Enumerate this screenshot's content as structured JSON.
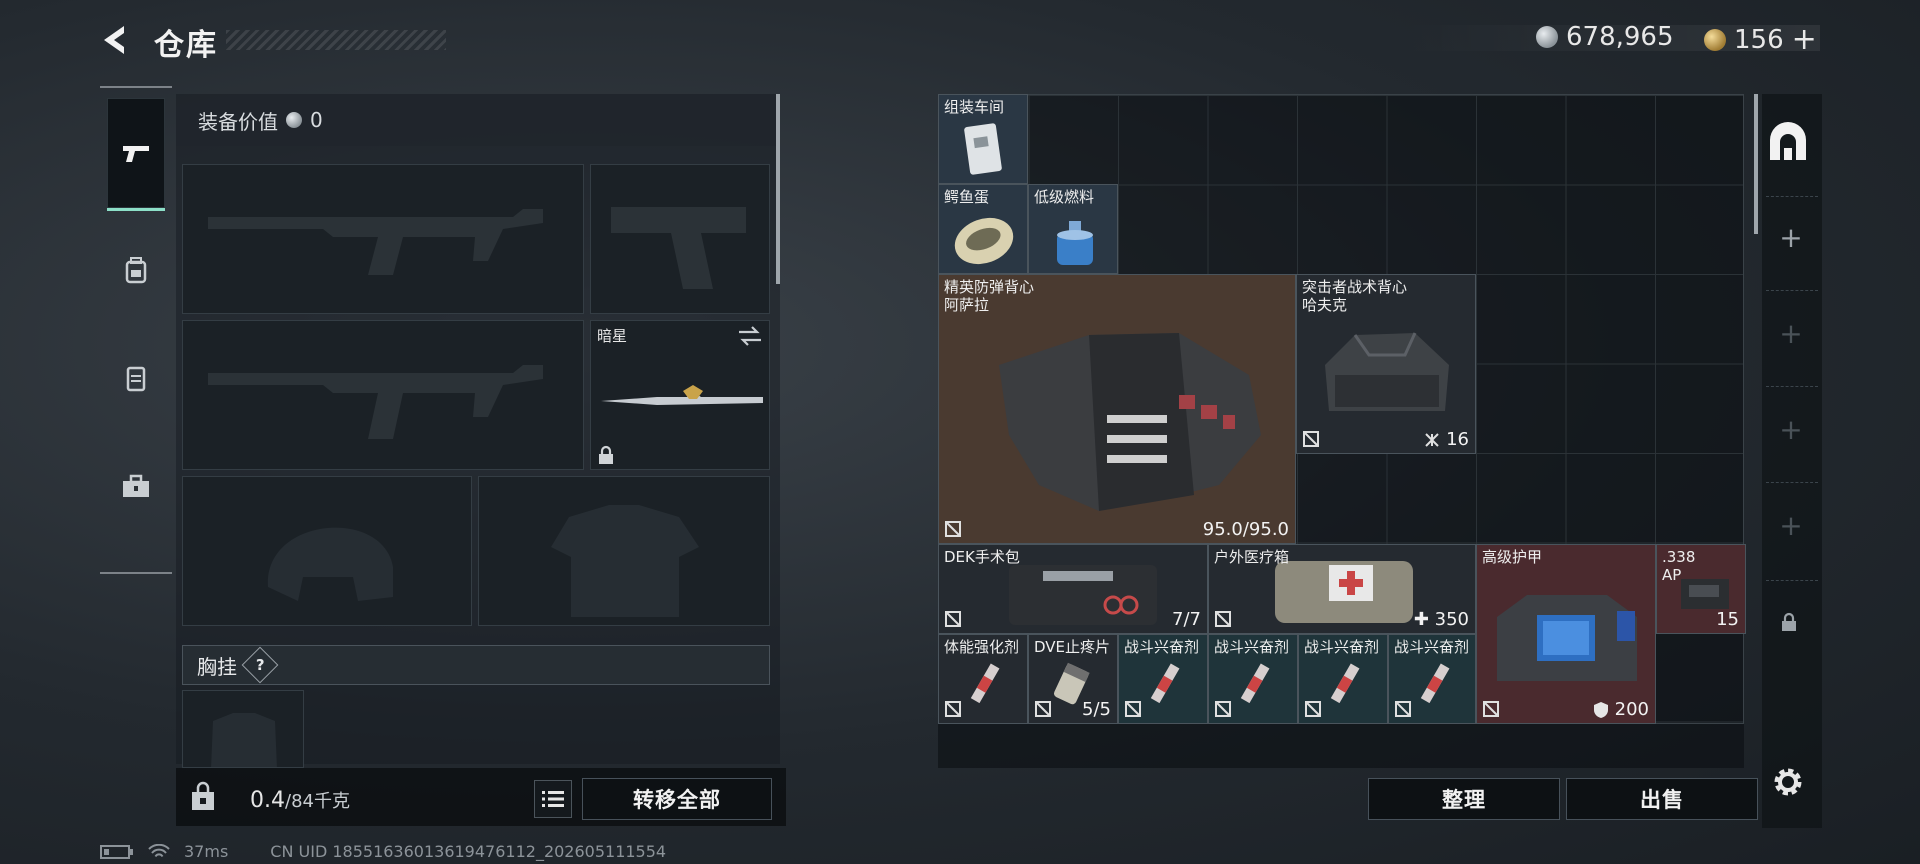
{
  "header": {
    "title": "仓库",
    "currency_silver": "678,965",
    "currency_gold": "156",
    "gold_add": "+",
    "colors": {
      "accent": "#8de0c8",
      "text": "#f2f2f2"
    }
  },
  "tabs": [
    {
      "icon": "pistol-icon",
      "active": true
    },
    {
      "icon": "backpack-icon",
      "active": false
    },
    {
      "icon": "vest-icon",
      "active": false
    },
    {
      "icon": "toolbox-icon",
      "active": false
    }
  ],
  "loadout": {
    "value_label": "装备价值",
    "value": "0",
    "melee_label": "暗星",
    "chest_rig_label": "胸挂",
    "chest_rig_help": "?",
    "weight_value": "0.4",
    "weight_max": "/84千克",
    "transfer_all": "转移全部"
  },
  "stash": {
    "items": [
      {
        "name": "组装车间",
        "color": "blue"
      },
      {
        "name": "鳄鱼蛋",
        "color": "blue"
      },
      {
        "name": "低级燃料",
        "color": "blue"
      },
      {
        "name": "精英防弹背心\n阿萨拉",
        "qty": "95.0/95.0",
        "color": "brown"
      },
      {
        "name": "突击者战术背心\n哈夫克",
        "qty": "16",
        "color": "dark"
      },
      {
        "name": "DEK手术包",
        "qty": "7/7",
        "color": "dark"
      },
      {
        "name": "户外医疗箱",
        "qty": "350",
        "color": "dark"
      },
      {
        "name": "高级护甲",
        "qty": "200",
        "color": "red"
      },
      {
        "name": ".338\nAP",
        "qty": "15",
        "color": "red"
      },
      {
        "name": "体能强化剂",
        "color": "dark"
      },
      {
        "name": "DVE止疼片",
        "qty": "5/5",
        "color": "dark"
      },
      {
        "name": "战斗兴奋剂",
        "color": "teal"
      },
      {
        "name": "战斗兴奋剂",
        "color": "teal"
      },
      {
        "name": "战斗兴奋剂",
        "color": "teal"
      },
      {
        "name": "战斗兴奋剂",
        "color": "teal"
      }
    ],
    "sort_label": "整理",
    "sell_label": "出售"
  },
  "status": {
    "ping": "37ms",
    "uid": "CN UID 18551636013619476112_202605111554"
  }
}
